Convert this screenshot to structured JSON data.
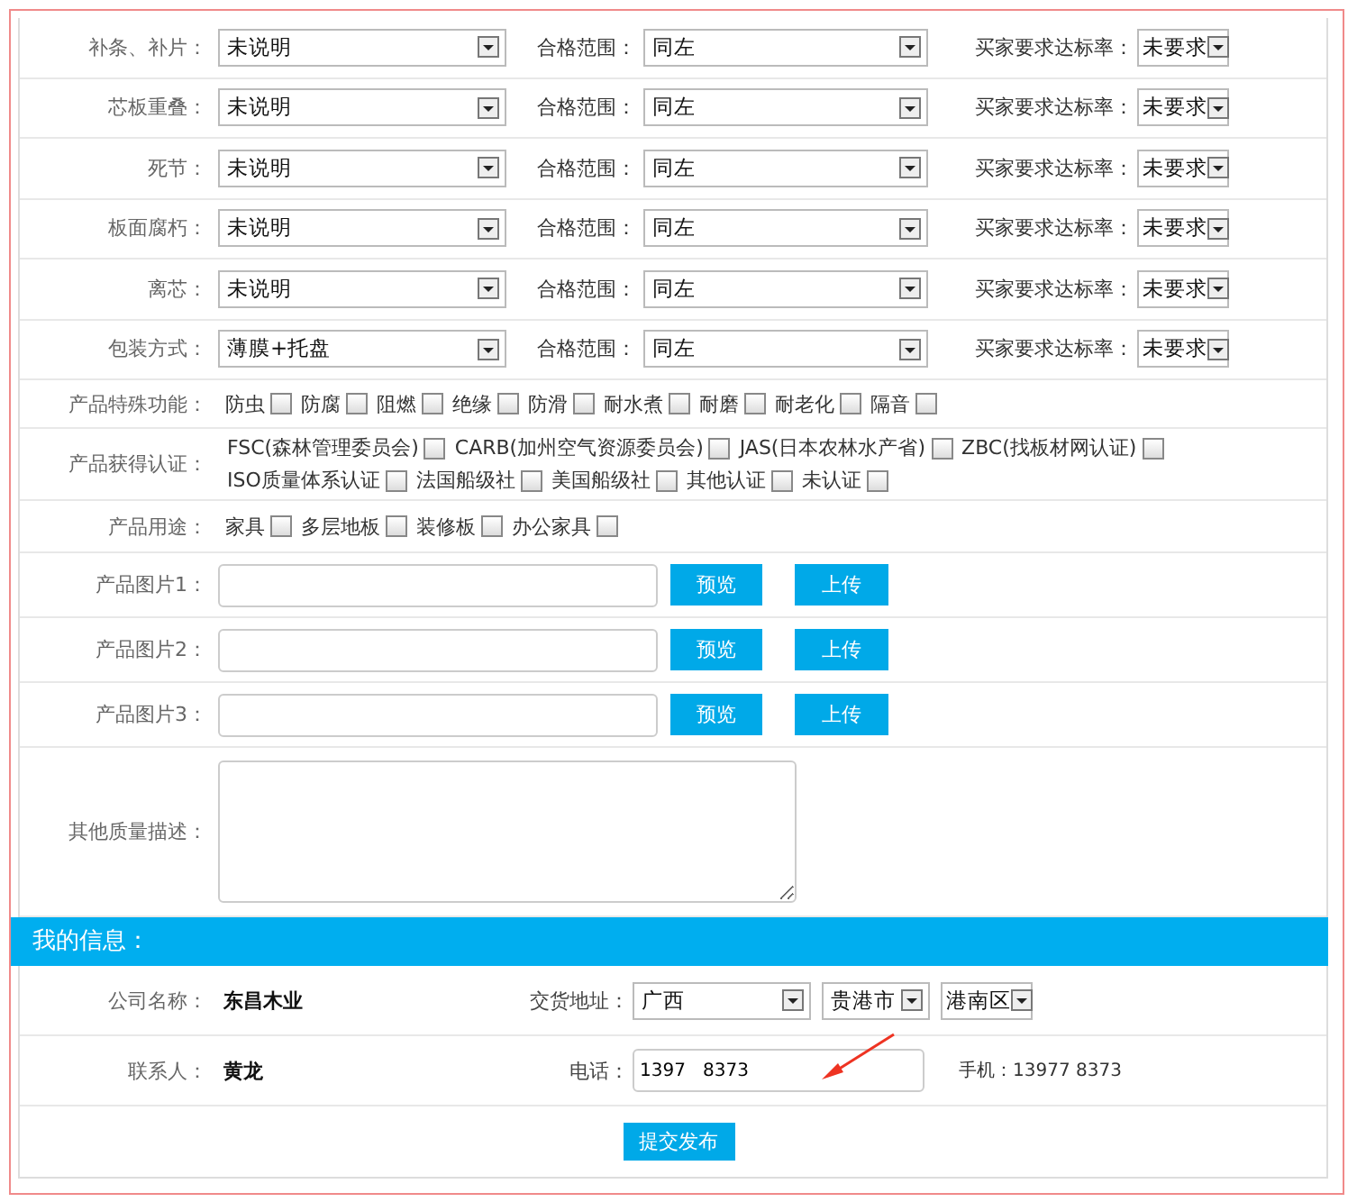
{
  "quality_rows": [
    {
      "label": "补条、补片：",
      "value": "未说明",
      "range_label": "合格范围：",
      "range_value": "同左",
      "rate_label": "买家要求达标率：",
      "rate_value": "未要求"
    },
    {
      "label": "芯板重叠：",
      "value": "未说明",
      "range_label": "合格范围：",
      "range_value": "同左",
      "rate_label": "买家要求达标率：",
      "rate_value": "未要求"
    },
    {
      "label": "死节：",
      "value": "未说明",
      "range_label": "合格范围：",
      "range_value": "同左",
      "rate_label": "买家要求达标率：",
      "rate_value": "未要求"
    },
    {
      "label": "板面腐朽：",
      "value": "未说明",
      "range_label": "合格范围：",
      "range_value": "同左",
      "rate_label": "买家要求达标率：",
      "rate_value": "未要求"
    },
    {
      "label": "离芯：",
      "value": "未说明",
      "range_label": "合格范围：",
      "range_value": "同左",
      "rate_label": "买家要求达标率：",
      "rate_value": "未要求"
    },
    {
      "label": "包装方式：",
      "value": "薄膜+托盘",
      "range_label": "合格范围：",
      "range_value": "同左",
      "rate_label": "买家要求达标率：",
      "rate_value": "未要求"
    }
  ],
  "checkbox_rows": [
    {
      "label": "产品特殊功能：",
      "options": [
        {
          "label": "防虫",
          "checked": false
        },
        {
          "label": "防腐",
          "checked": false
        },
        {
          "label": "阻燃",
          "checked": false
        },
        {
          "label": "绝缘",
          "checked": false
        },
        {
          "label": "防滑",
          "checked": false
        },
        {
          "label": "耐水煮",
          "checked": false
        },
        {
          "label": "耐磨",
          "checked": false
        },
        {
          "label": "耐老化",
          "checked": false
        },
        {
          "label": "隔音",
          "checked": false
        }
      ]
    },
    {
      "label": "产品获得认证：",
      "options": [
        {
          "label": "FSC(森林管理委员会)",
          "checked": false
        },
        {
          "label": "CARB(加州空气资源委员会)",
          "checked": false
        },
        {
          "label": "JAS(日本农林水产省)",
          "checked": false
        },
        {
          "label": "ZBC(找板材网认证)",
          "checked": false
        },
        {
          "label": "ISO质量体系认证",
          "checked": false
        },
        {
          "label": "法国船级社",
          "checked": false
        },
        {
          "label": "美国船级社",
          "checked": false
        },
        {
          "label": "其他认证",
          "checked": false
        },
        {
          "label": "未认证",
          "checked": false
        }
      ]
    },
    {
      "label": "产品用途：",
      "options": [
        {
          "label": "家具",
          "checked": false
        },
        {
          "label": "多层地板",
          "checked": false
        },
        {
          "label": "装修板",
          "checked": false
        },
        {
          "label": "办公家具",
          "checked": false
        }
      ]
    }
  ],
  "image_rows": [
    {
      "label": "产品图片1：",
      "preview_button": "预览",
      "upload_button": "上传"
    },
    {
      "label": "产品图片2：",
      "preview_button": "预览",
      "upload_button": "上传"
    },
    {
      "label": "产品图片3：",
      "preview_button": "预览",
      "upload_button": "上传"
    }
  ],
  "description": {
    "label": "其他质量描述："
  },
  "section_title": "我的信息：",
  "company": {
    "label": "公司名称：",
    "value": "东昌木业"
  },
  "delivery": {
    "label": "交货地址：",
    "province": "广西",
    "city": "贵港市",
    "district": "港南区"
  },
  "contact": {
    "label": "联系人：",
    "value": "黄龙"
  },
  "phone": {
    "label": "电话：",
    "value": "1397   8373"
  },
  "mobile": {
    "label": "手机：",
    "value": "13977  8373"
  },
  "submit_button": "提交发布"
}
